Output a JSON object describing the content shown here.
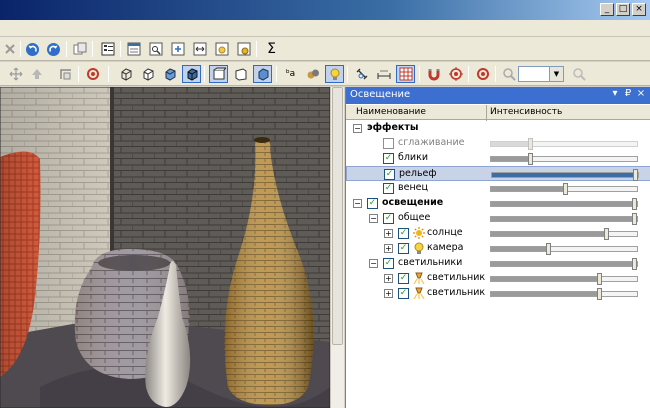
{
  "window": {
    "controls": [
      "_",
      "□",
      "×"
    ]
  },
  "toolbar1": {
    "sigma_label": "Σ"
  },
  "toolbar2": {
    "text_tool_label": "ᵇa",
    "zoom_value": ""
  },
  "panel": {
    "title": "Освещение",
    "controls": [
      "▾",
      "₽",
      "×"
    ],
    "columns": {
      "name": "Наименование",
      "intensity": "Интенсивность"
    },
    "rows": [
      {
        "label": "эффекты",
        "bold": true,
        "level": 0,
        "expander": "−",
        "checkbox": null,
        "icon": null
      },
      {
        "label": "сглаживание",
        "level": 1,
        "checkbox": false,
        "disabled": true,
        "intensity": 0.27
      },
      {
        "label": "блики",
        "level": 1,
        "checkbox": true,
        "intensity": 0.27
      },
      {
        "label": "рельеф",
        "level": 1,
        "checkbox": true,
        "selected": true,
        "intensity": 1.0
      },
      {
        "label": "венец",
        "level": 1,
        "checkbox": true,
        "intensity": 0.51
      },
      {
        "label": "освещение",
        "bold": true,
        "level": 0,
        "expander": "−",
        "checkbox": true,
        "intensity": 1.0
      },
      {
        "label": "общее",
        "level": 1,
        "expander": "−",
        "checkbox": true,
        "intensity": 1.0
      },
      {
        "label": "солнце",
        "level": 2,
        "expander": "+",
        "checkbox": true,
        "icon": "sun-icon",
        "intensity": 0.79
      },
      {
        "label": "камера",
        "level": 2,
        "expander": "+",
        "checkbox": true,
        "icon": "bulb-icon",
        "intensity": 0.39
      },
      {
        "label": "светильники",
        "level": 1,
        "expander": "−",
        "checkbox": true,
        "intensity": 1.0
      },
      {
        "label": "светильник",
        "level": 2,
        "expander": "+",
        "checkbox": true,
        "icon": "spotlight-icon",
        "intensity": 0.74
      },
      {
        "label": "светильник",
        "level": 2,
        "expander": "+",
        "checkbox": true,
        "icon": "spotlight-icon",
        "intensity": 0.74
      }
    ]
  },
  "colors": {
    "panel_title_bg": "#3d6fd0",
    "selection_bg": "#c9d3e8",
    "check_green": "#21a121"
  }
}
